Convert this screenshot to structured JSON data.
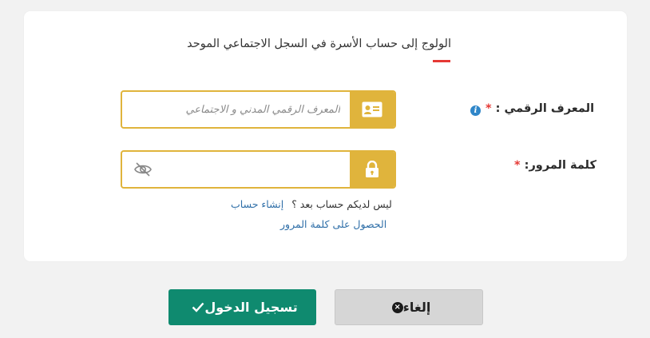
{
  "form": {
    "title": "الولوج إلى حساب الأسرة في السجل الاجتماعي الموحد",
    "digital_id": {
      "label": "المعرف الرقمي :",
      "required_mark": "*",
      "placeholder": "المعرف الرقمي المدني و الاجتماعي",
      "value": ""
    },
    "password": {
      "label": "كلمة المرور:",
      "required_mark": "*",
      "value": ""
    },
    "no_account_text": "ليس لديكم حساب بعد ؟",
    "create_account_link": "إنشاء حساب",
    "get_password_link": "الحصول على كلمة المرور"
  },
  "actions": {
    "login_label": "تسجيل الدخول",
    "cancel_label": "إلغاء"
  },
  "colors": {
    "accent_gold": "#e0b43c",
    "primary_green": "#0f8a6f",
    "required_red": "#e53935",
    "link_blue": "#2f6fa8",
    "info_blue": "#2f86c9"
  }
}
